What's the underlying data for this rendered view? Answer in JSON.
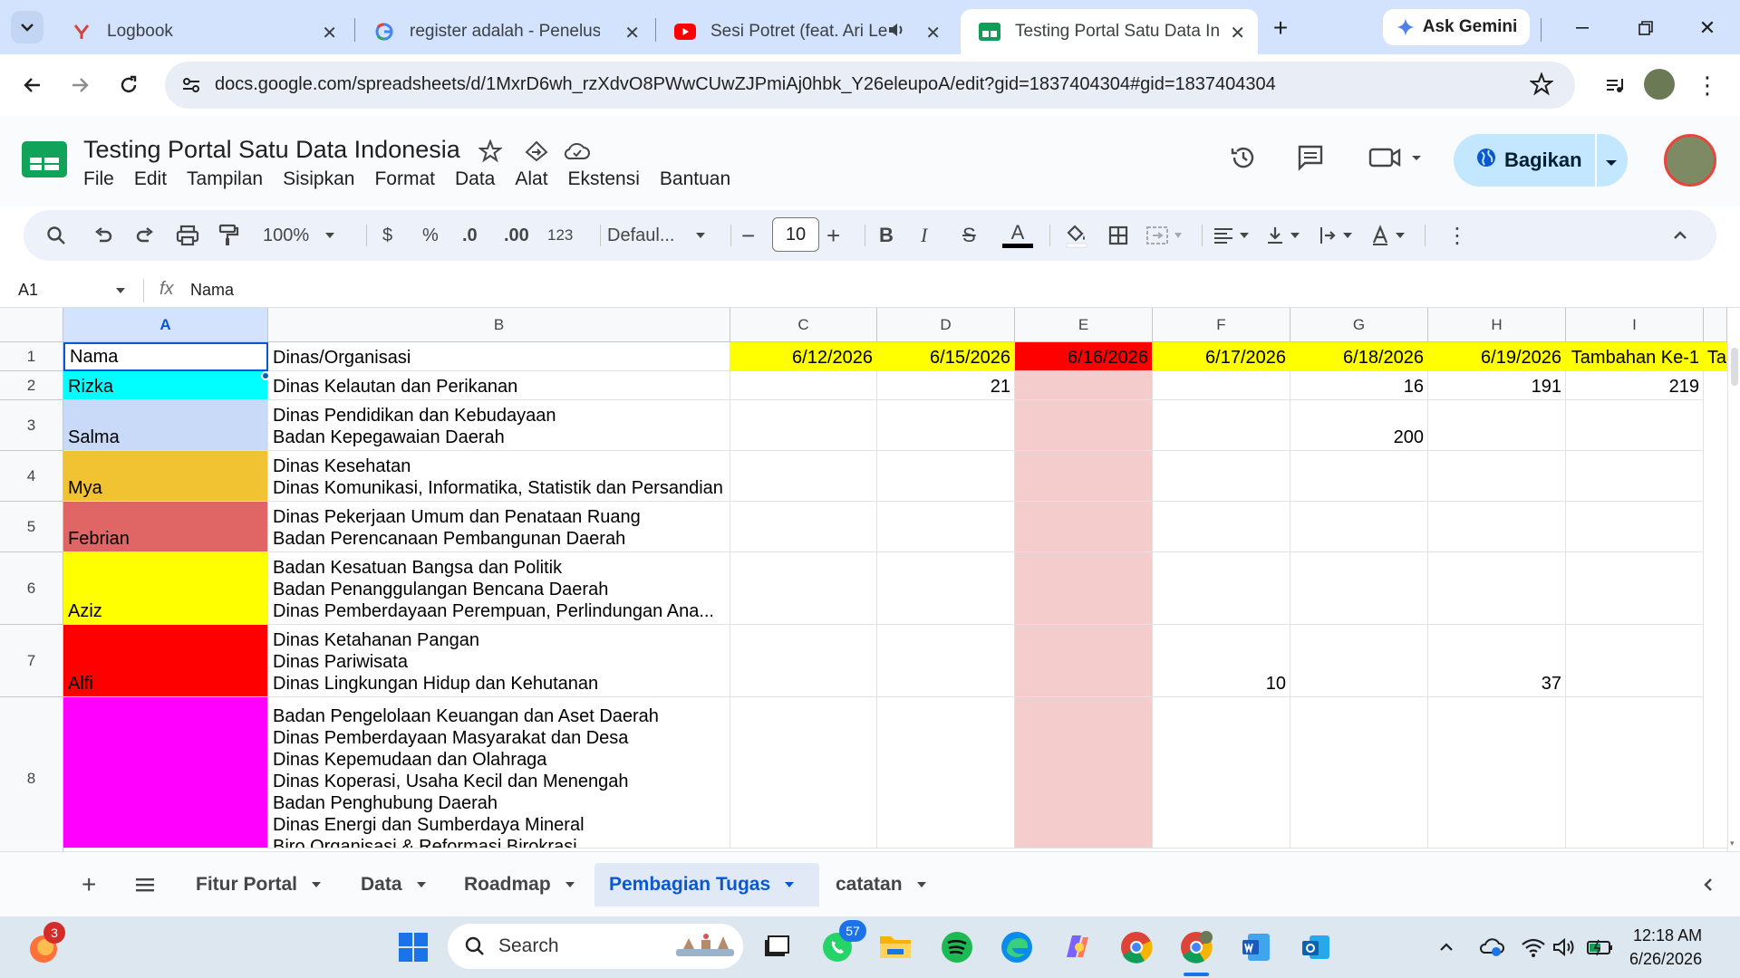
{
  "browser": {
    "tabs": [
      {
        "title": "Logbook"
      },
      {
        "title": "register adalah - Penelusuran"
      },
      {
        "title": "Sesi Potret (feat. Ari Lesmana)"
      },
      {
        "title": "Testing Portal Satu Data Indonesia"
      }
    ],
    "ask_gemini": "Ask Gemini",
    "url": "docs.google.com/spreadsheets/d/1MxrD6wh_rzXdvO8PWwCUwZJPmiAj0hbk_Y26eleupoA/edit?gid=1837404304#gid=1837404304"
  },
  "doc": {
    "title": "Testing Portal Satu Data Indonesia",
    "menu": [
      "File",
      "Edit",
      "Tampilan",
      "Sisipkan",
      "Format",
      "Data",
      "Alat",
      "Ekstensi",
      "Bantuan"
    ],
    "share_label": "Bagikan"
  },
  "toolbar": {
    "zoom": "100%",
    "currency": "$",
    "percent": "%",
    "dec_decrease": ".0",
    "dec_increase": ".00",
    "number_format": "123",
    "font": "Defaul...",
    "font_size": "10",
    "bold": "B",
    "italic": "I",
    "strike": "S",
    "text_color": "A"
  },
  "formula_bar": {
    "cell_ref": "A1",
    "fx": "fx",
    "value": "Nama"
  },
  "grid": {
    "columns": [
      "A",
      "B",
      "C",
      "D",
      "E",
      "F",
      "G",
      "H",
      "I"
    ],
    "rows": [
      {
        "num": "1",
        "cells": [
          "Nama",
          "Dinas/Organisasi",
          "6/12/2026",
          "6/15/2026",
          "6/16/2026",
          "6/17/2026",
          "6/18/2026",
          "6/19/2026",
          "Tambahan Ke-1",
          "Ta"
        ]
      },
      {
        "num": "2",
        "cells": [
          "Rizka",
          "Dinas Kelautan dan Perikanan",
          "",
          "21",
          "",
          "",
          "16",
          "191",
          "219"
        ]
      },
      {
        "num": "3",
        "cells": [
          "Salma",
          "Dinas Pendidikan dan Kebudayaan\nBadan Kepegawaian Daerah",
          "",
          "",
          "",
          "",
          "200",
          "",
          ""
        ]
      },
      {
        "num": "4",
        "cells": [
          "Mya",
          "Dinas Kesehatan\nDinas Komunikasi, Informatika, Statistik dan Persandian",
          "",
          "",
          "",
          "",
          "",
          "",
          ""
        ]
      },
      {
        "num": "5",
        "cells": [
          "Febrian",
          "Dinas Pekerjaan Umum dan Penataan Ruang\nBadan Perencanaan Pembangunan Daerah",
          "",
          "",
          "",
          "",
          "",
          "",
          ""
        ]
      },
      {
        "num": "6",
        "cells": [
          "Aziz",
          "Badan Kesatuan Bangsa dan Politik\nBadan Penanggulangan Bencana Daerah\nDinas Pemberdayaan Perempuan, Perlindungan Ana...",
          "",
          "",
          "",
          "",
          "",
          "",
          ""
        ]
      },
      {
        "num": "7",
        "cells": [
          "Alfi",
          "Dinas Ketahanan Pangan\nDinas Pariwisata\nDinas Lingkungan Hidup dan Kehutanan",
          "",
          "",
          "",
          "10",
          "",
          "37",
          ""
        ]
      },
      {
        "num": "8",
        "cells": [
          "",
          "Badan Pengelolaan Keuangan dan Aset Daerah\nDinas Pemberdayaan Masyarakat dan Desa\nDinas Kepemudaan dan Olahraga\nDinas Koperasi, Usaha Kecil dan Menengah\nBadan Penghubung Daerah\nDinas Energi dan Sumberdaya Mineral\nBiro Organisasi & Reformasi Birokrasi",
          "",
          "",
          "",
          "",
          "",
          "",
          ""
        ]
      }
    ]
  },
  "sheets": {
    "tabs": [
      "Fitur Portal",
      "Data",
      "Roadmap",
      "Pembagian Tugas",
      "catatan"
    ],
    "active": "Pembagian Tugas"
  },
  "taskbar": {
    "search_placeholder": "Search",
    "badge_firefox": "3",
    "badge_whatsapp": "57",
    "time": "12:18 AM",
    "date": "6/26/2026"
  },
  "colors": {
    "accent": "#0b57d0",
    "yellow": "#ffff00",
    "red": "#ff0000",
    "pink": "#f4cccc",
    "cyan": "#00ffff",
    "lavender": "#c9daf8",
    "orange": "#f1c232",
    "salmon": "#e06666",
    "magenta": "#ff00ff"
  }
}
